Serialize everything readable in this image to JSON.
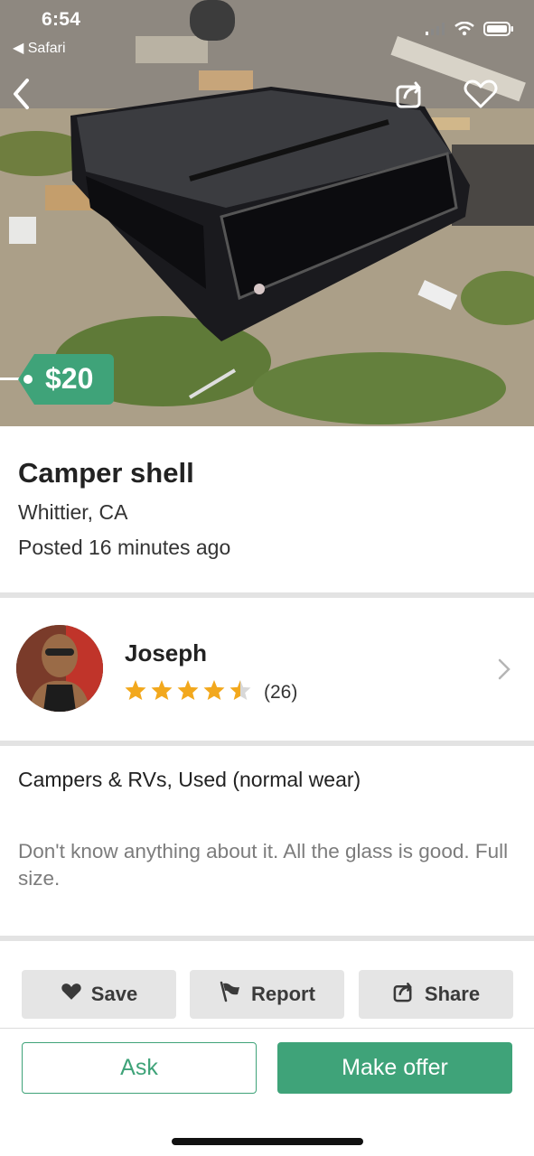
{
  "status_bar": {
    "time": "6:54",
    "back_app": "◀ Safari"
  },
  "listing": {
    "price": "$20",
    "title": "Camper shell",
    "location": "Whittier, CA",
    "posted": "Posted 16 minutes ago",
    "category_condition": "Campers & RVs, Used (normal wear)",
    "description": "Don't know anything about it. All the glass is good. Full size."
  },
  "seller": {
    "name": "Joseph",
    "rating": 4.5,
    "rating_count": "(26)"
  },
  "actions": {
    "save_label": "Save",
    "report_label": "Report",
    "share_label": "Share"
  },
  "cta": {
    "ask_label": "Ask",
    "offer_label": "Make offer"
  },
  "colors": {
    "accent": "#3fa379",
    "star": "#f2a81d",
    "button_bg": "#e5e5e5"
  },
  "icons": [
    "back-chevron-icon",
    "share-icon",
    "heart-icon",
    "heart-filled-icon",
    "flag-icon",
    "chevron-right-icon",
    "star-icon",
    "wifi-icon",
    "battery-icon",
    "signal-icon"
  ]
}
